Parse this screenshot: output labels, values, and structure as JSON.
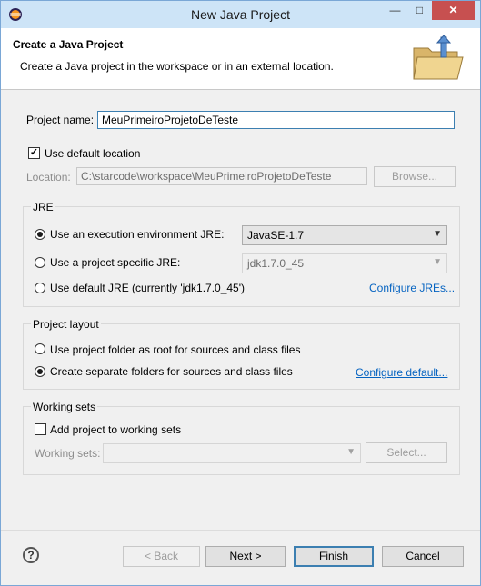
{
  "window": {
    "title": "New Java Project"
  },
  "header": {
    "title": "Create a Java Project",
    "description": "Create a Java project in the workspace or in an external location."
  },
  "project": {
    "name_label": "Project name:",
    "name_value": "MeuPrimeiroProjetoDeTeste"
  },
  "location": {
    "use_default_label": "Use default location",
    "use_default_checked": true,
    "label": "Location:",
    "value": "C:\\starcode\\workspace\\MeuPrimeiroProjetoDeTeste",
    "browse_label": "Browse..."
  },
  "jre": {
    "group_label": "JRE",
    "option_env_label": "Use an execution environment JRE:",
    "option_env_value": "JavaSE-1.7",
    "option_specific_label": "Use a project specific JRE:",
    "option_specific_value": "jdk1.7.0_45",
    "option_default_label": "Use default JRE (currently 'jdk1.7.0_45')",
    "configure_link": "Configure JREs...",
    "selected": "env"
  },
  "layout": {
    "group_label": "Project layout",
    "option_root_label": "Use project folder as root for sources and class files",
    "option_separate_label": "Create separate folders for sources and class files",
    "configure_link": "Configure default...",
    "selected": "separate"
  },
  "working_sets": {
    "group_label": "Working sets",
    "add_label": "Add project to working sets",
    "add_checked": false,
    "sets_label": "Working sets:",
    "select_label": "Select..."
  },
  "footer": {
    "back": "< Back",
    "next": "Next >",
    "finish": "Finish",
    "cancel": "Cancel"
  },
  "icons": {
    "app": "eclipse-icon",
    "banner": "java-project-folder-icon",
    "help": "help-icon",
    "minimize": "minimize-icon",
    "maximize": "maximize-icon",
    "close": "close-icon"
  }
}
